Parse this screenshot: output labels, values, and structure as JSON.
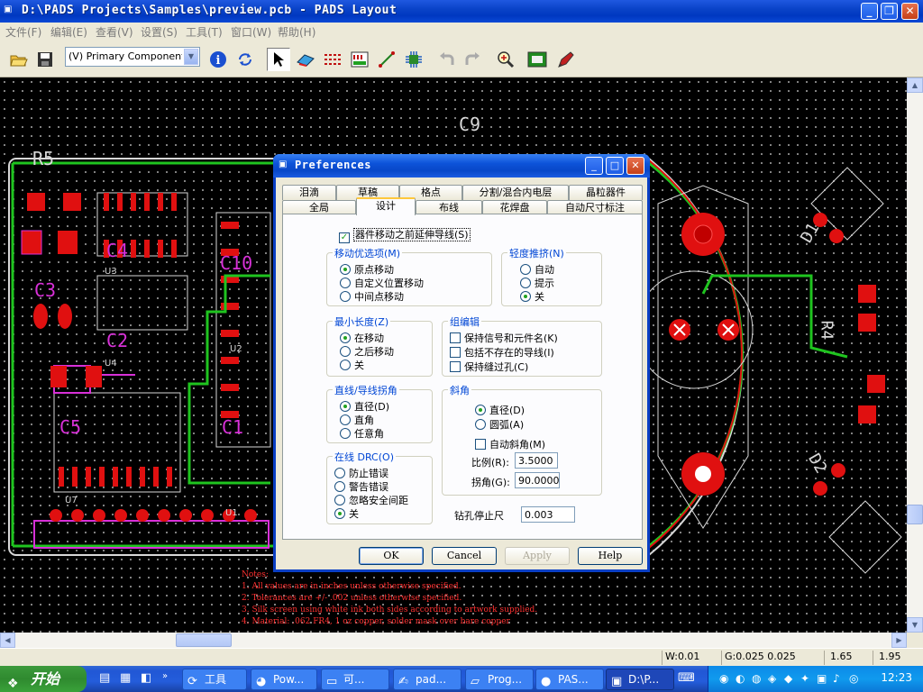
{
  "window": {
    "title": "D:\\PADS Projects\\Samples\\preview.pcb - PADS Layout",
    "minimize": "_",
    "maximize": "❐",
    "close": "✕"
  },
  "menu": [
    "文件(F)",
    "编辑(E)",
    "查看(V)",
    "设置(S)",
    "工具(T)",
    "窗口(W)",
    "帮助(H)"
  ],
  "toolbar": {
    "layer_select": "(V) Primary Component Sic",
    "icons": [
      "open-folder-icon",
      "save-icon",
      "info-icon",
      "refresh-icon",
      "select-arrow-icon",
      "3d-view-icon",
      "route-icon",
      "pad-stack-icon",
      "line-icon",
      "via-icon",
      "undo-icon",
      "redo-icon",
      "zoom-icon",
      "board-icon",
      "pen-icon"
    ]
  },
  "canvas": {
    "labels": [
      "C9",
      "R5",
      "C4",
      "C10",
      "C2",
      "C3",
      "C5",
      "C1",
      "D1",
      "R4",
      "D2",
      "U1",
      "U2",
      "U3",
      "U4",
      "U7"
    ],
    "notes": [
      "Notes:",
      "1.  All values are in inches unless otherwise specified.",
      "2.  Tolerances are +/- .002 unless otherwise specified.",
      "3.  Silk screen using white ink both sides according to artwork supplied.",
      "4.  Material: .062 FR4, 1 oz copper, solder mask over bare copper"
    ]
  },
  "dialog": {
    "title": "Preferences",
    "tabs_row1": [
      "泪滴",
      "草稿",
      "格点",
      "分割/混合内电层",
      "晶粒器件"
    ],
    "tabs_row2": [
      "全局",
      "设计",
      "布线",
      "花焊盘",
      "自动尺寸标注"
    ],
    "selected_tab": "设计",
    "stretch_traces": {
      "label": "器件移动之前延伸导线(S)",
      "checked": true
    },
    "move_pref": {
      "title": "移动优选项(M)",
      "options": [
        "原点移动",
        "自定义位置移动",
        "中间点移动"
      ],
      "selected": 0
    },
    "nudge": {
      "title": "轻度推挤(N)",
      "options": [
        "自动",
        "提示",
        "关"
      ],
      "selected": 2
    },
    "min_length": {
      "title": "最小长度(Z)",
      "options": [
        "在移动",
        "之后移动",
        "关"
      ],
      "selected": 0
    },
    "group_edit": {
      "title": "组编辑",
      "options": [
        "保持信号和元件名(K)",
        "包括不存在的导线(I)",
        "保持缝过孔(C)"
      ],
      "checked": [
        false,
        false,
        false
      ]
    },
    "line_corner": {
      "title": "直线/导线拐角",
      "options": [
        "直径(D)",
        "直角",
        "任意角"
      ],
      "selected": 0
    },
    "miter": {
      "title": "斜角",
      "options": [
        "直径(D)",
        "圆弧(A)"
      ],
      "selected": 0,
      "auto_miter": "自动斜角(M)",
      "ratio_label": "比例(R):",
      "ratio": "3.5000",
      "angle_label": "拐角(G):",
      "angle": "90.0000"
    },
    "online_drc": {
      "title": "在线 DRC(O)",
      "options": [
        "防止错误",
        "警告错误",
        "忽略安全间距",
        "关"
      ],
      "selected": 3
    },
    "drill_oversize": {
      "label": "钻孔停止尺",
      "value": "0.003"
    },
    "buttons": {
      "ok": "OK",
      "cancel": "Cancel",
      "apply": "Apply",
      "help": "Help"
    }
  },
  "status": {
    "width": "W:0.01",
    "grid": "G:0.025 0.025",
    "x": "1.65",
    "y": "1.95"
  },
  "taskbar": {
    "start": "开始",
    "tasks": [
      "工具",
      "Pow...",
      "可...",
      "pad...",
      "Prog...",
      "PAS...",
      "D:\\P..."
    ],
    "clock": "12:23"
  },
  "colors": {
    "trace_green": "#1fc41f",
    "pad_red": "#e01010",
    "silk_magenta": "#d830d8",
    "outline_white": "#d8d8d8",
    "titlebar_blue": "#0a43c8"
  }
}
